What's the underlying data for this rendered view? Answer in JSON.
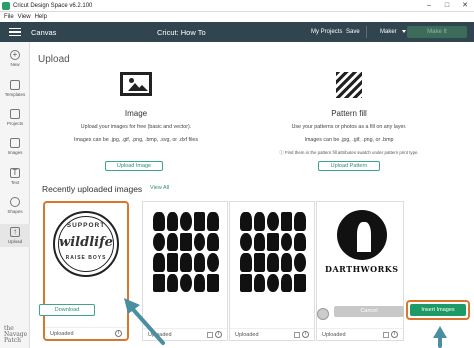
{
  "window": {
    "title": "Cricut Design Space  v6.2.100",
    "controls": {
      "minimize": "–",
      "maximize": "□",
      "close": "✕"
    }
  },
  "menu": [
    "File",
    "View",
    "Help"
  ],
  "appbar": {
    "canvas_label": "Canvas",
    "project_title": "Cricut: How To",
    "my_projects": "My Projects",
    "save": "Save",
    "machine": "Maker",
    "make_it": "Make It"
  },
  "sidebar": [
    {
      "label": "New",
      "icon": "plus-icon"
    },
    {
      "label": "Templates",
      "icon": "shirt-icon"
    },
    {
      "label": "Projects",
      "icon": "clipboard-icon"
    },
    {
      "label": "Images",
      "icon": "image-icon"
    },
    {
      "label": "Text",
      "icon": "text-icon"
    },
    {
      "label": "Shapes",
      "icon": "shapes-icon"
    },
    {
      "label": "Upload",
      "icon": "upload-icon"
    }
  ],
  "upload": {
    "title": "Upload",
    "image": {
      "title": "Image",
      "desc": "Upload your images for free (basic and vector).",
      "formats": "Images can be .jpg, .gif, .png, .bmp, .svg, or .dxf files",
      "button": "Upload Image"
    },
    "pattern": {
      "title": "Pattern fill",
      "desc": "Use your patterns or photos as a fill on any layer.",
      "formats": "Images can be .jpg, .gif, .png, or .bmp",
      "note": "Find them in the pattern fill attributes swatch under pattern print type.",
      "button": "Upload Pattern"
    }
  },
  "recent": {
    "title": "Recently uploaded images",
    "view_all": "View All",
    "cards": [
      {
        "status": "Uploaded",
        "badge_top": "SUPPORT",
        "badge_mid": "wildlife",
        "badge_bottom": "RAISE BOYS"
      },
      {
        "status": "Uploaded"
      },
      {
        "status": "Uploaded"
      },
      {
        "status": "Uploaded",
        "logo_text": "DARTHWORKS"
      }
    ]
  },
  "footer": {
    "download": "Download",
    "cancel": "Cancel",
    "insert": "Insert Images"
  },
  "watermark": [
    "the",
    "Navage",
    "Patch"
  ],
  "colors": {
    "appbar": "#30454f",
    "accent": "#1e9a66",
    "highlight": "#d9762c",
    "annotation_arrow": "#4a8fa1"
  }
}
